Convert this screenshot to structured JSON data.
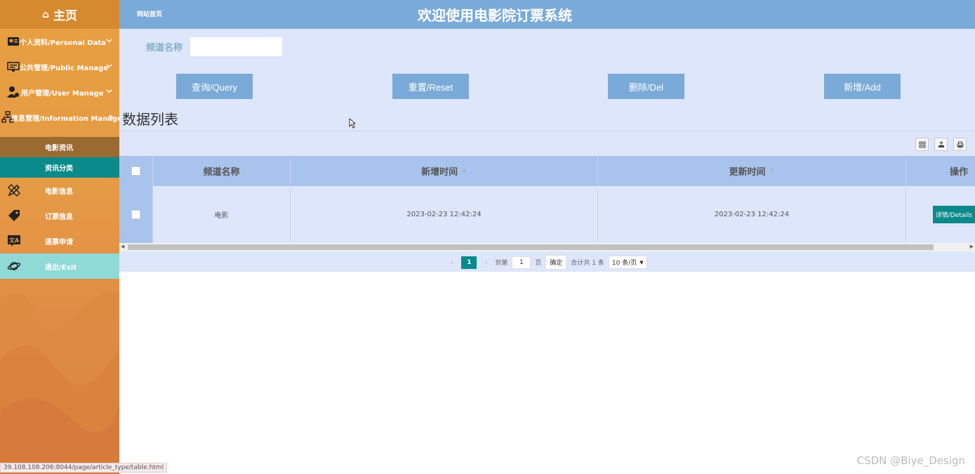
{
  "sidebar": {
    "brand": "主页",
    "menu": [
      {
        "label": "个人资料/Personal Data"
      },
      {
        "label": "公共管理/Public Manage"
      },
      {
        "label": "用户管理/User Manage"
      },
      {
        "label": "信息管理/Information Manage"
      }
    ],
    "submenu": [
      {
        "label": "电影资讯"
      },
      {
        "label": "资讯分类"
      }
    ],
    "items": [
      {
        "label": "电影信息"
      },
      {
        "label": "订票信息"
      },
      {
        "label": "退票申请"
      },
      {
        "label": "退出/Exit"
      }
    ]
  },
  "header": {
    "home_link": "网站首页",
    "title": "欢迎使用电影院订票系统"
  },
  "search": {
    "label": "频道名称",
    "value": ""
  },
  "buttons": {
    "query": "查询/Query",
    "reset": "重置/Reset",
    "delete": "删除/Del",
    "add": "新增/Add"
  },
  "section_title": "数据列表",
  "table": {
    "headers": [
      "频道名称",
      "新增时间",
      "更新时间",
      "操作"
    ],
    "rows": [
      {
        "channel": "电影",
        "created": "2023-02-23 12:42:24",
        "updated": "2023-02-23 12:42:24",
        "action": "详情/Details"
      }
    ]
  },
  "pager": {
    "current_page": "1",
    "goto_label": "到第",
    "goto_value": "1",
    "page_suffix": "页",
    "confirm": "确定",
    "total": "合计共 1 条",
    "page_size": "10 条/页"
  },
  "statusbar": "39.108.108.206:8044/page/article_type/table.html",
  "watermark": "CSDN @Biye_Design"
}
